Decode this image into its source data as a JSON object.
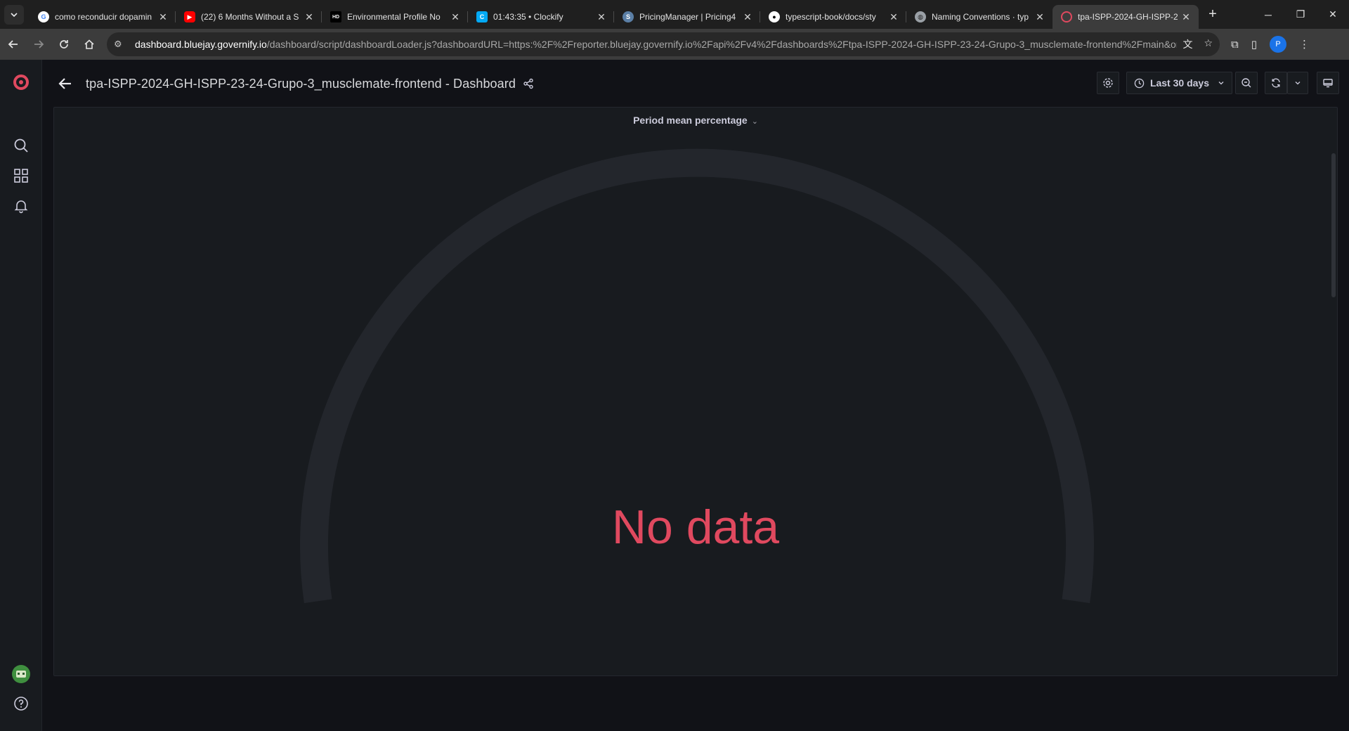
{
  "browser": {
    "tabs": [
      {
        "title": "como reconducir dopamin",
        "favicon": "google-icon",
        "color": "#ffffff",
        "active": false
      },
      {
        "title": "(22) 6 Months Without a S",
        "favicon": "youtube-icon",
        "color": "#ff0000",
        "active": false
      },
      {
        "title": "Environmental Profile No",
        "favicon": "hd-icon",
        "color": "#000000",
        "active": false
      },
      {
        "title": "01:43:35 • Clockify",
        "favicon": "clockify-icon",
        "color": "#03a9f4",
        "active": false
      },
      {
        "title": "PricingManager | Pricing4",
        "favicon": "pricing-icon",
        "color": "#5b7fa6",
        "active": false
      },
      {
        "title": "typescript-book/docs/sty",
        "favicon": "github-icon",
        "color": "#ffffff",
        "active": false
      },
      {
        "title": "Naming Conventions · typ",
        "favicon": "globe-icon",
        "color": "#9aa0a6",
        "active": false
      },
      {
        "title": "tpa-ISPP-2024-GH-ISPP-2",
        "favicon": "grafana-icon",
        "color": "#e0495f",
        "active": true
      }
    ],
    "url_host": "dashboard.bluejay.governify.io",
    "url_path": "/dashboard/script/dashboardLoader.js?dashboardURL=https:%2F%2Freporter.bluejay.governify.io%2Fapi%2Fv4%2Fdashboards%2Ftpa-ISPP-2024-GH-ISPP-23-24-Grupo-3_musclemate-frontend%2Fmain&org...",
    "profile_initial": "P"
  },
  "dashboard": {
    "title": "tpa-ISPP-2024-GH-ISPP-23-24-Grupo-3_musclemate-frontend - Dashboard",
    "time_range": "Last 30 days"
  },
  "panel": {
    "title": "Period mean percentage",
    "no_data": "No data"
  },
  "colors": {
    "accent": "#e0495f",
    "panel_bg": "#181b1f",
    "page_bg": "#111217"
  }
}
